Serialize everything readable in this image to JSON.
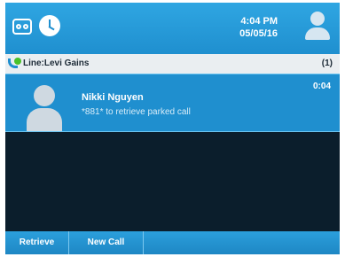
{
  "status_bar": {
    "time": "4:04 PM",
    "date": "05/05/16",
    "icons": [
      "voicemail-icon",
      "clock-icon",
      "user-avatar-icon"
    ]
  },
  "line": {
    "label": "Line:Levi Gains",
    "count": "(1)",
    "status_color": "#49c22a"
  },
  "call": {
    "caller_name": "Nikki Nguyen",
    "status_text": "*881* to retrieve parked call",
    "timer": "0:04"
  },
  "softkeys": {
    "retrieve": "Retrieve",
    "new_call": "New Call"
  },
  "colors": {
    "accent": "#1f8fcf",
    "background": "#0b1e2c",
    "line_bar": "#eaeef1"
  }
}
